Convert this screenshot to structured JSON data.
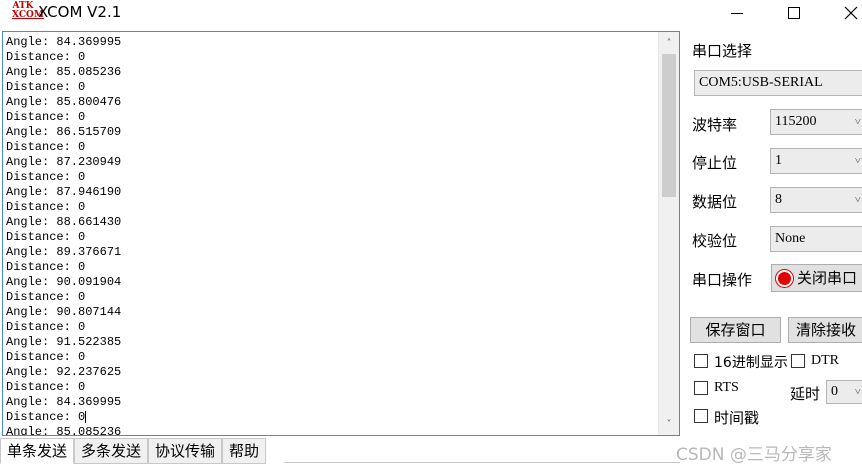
{
  "window": {
    "title": "XCOM V2.1",
    "logo_top": "ATK",
    "logo_bottom": "XCOM"
  },
  "receive": {
    "lines": [
      "Angle: 84.369995",
      "Distance: 0",
      "Angle: 85.085236",
      "Distance: 0",
      "Angle: 85.800476",
      "Distance: 0",
      "Angle: 86.515709",
      "Distance: 0",
      "Angle: 87.230949",
      "Distance: 0",
      "Angle: 87.946190",
      "Distance: 0",
      "Angle: 88.661430",
      "Distance: 0",
      "Angle: 89.376671",
      "Distance: 0",
      "Angle: 90.091904",
      "Distance: 0",
      "Angle: 90.807144",
      "Distance: 0",
      "Angle: 91.522385",
      "Distance: 0",
      "Angle: 92.237625",
      "Distance: 0",
      "Angle: 84.369995",
      "Distance: 0",
      "Angle: 85.085236"
    ]
  },
  "tabs": [
    "单条发送",
    "多条发送",
    "协议传输",
    "帮助"
  ],
  "panel": {
    "port_select_label": "串口选择",
    "port_value": "COM5:USB-SERIAL",
    "baud_label": "波特率",
    "baud_value": "115200",
    "stopbits_label": "停止位",
    "stopbits_value": "1",
    "databits_label": "数据位",
    "databits_value": "8",
    "parity_label": "校验位",
    "parity_value": "None",
    "operate_label": "串口操作",
    "close_port_label": "关闭串口",
    "save_window_label": "保存窗口",
    "clear_recv_label": "清除接收",
    "hex_display_label": "16进制显示",
    "dtr_label": "DTR",
    "rts_label": "RTS",
    "delay_label": "延时",
    "delay_value": "0",
    "timestamp_label": "时间戳"
  },
  "watermark": "CSDN @三马分享家"
}
